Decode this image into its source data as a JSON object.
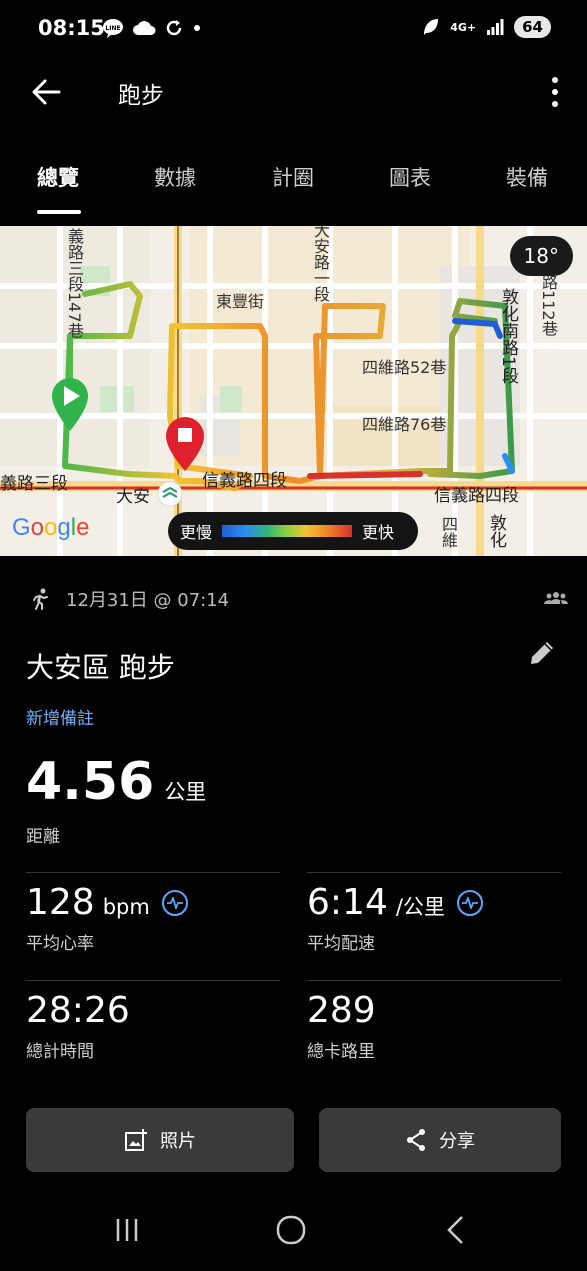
{
  "status_bar": {
    "time": "08:15",
    "network": "4G+",
    "battery": "64"
  },
  "app_bar": {
    "title": "跑步"
  },
  "tabs": [
    {
      "label": "總覽",
      "active": true
    },
    {
      "label": "數據",
      "active": false
    },
    {
      "label": "計圈",
      "active": false
    },
    {
      "label": "圖表",
      "active": false
    },
    {
      "label": "裝備",
      "active": false
    }
  ],
  "map": {
    "temperature": "18°",
    "street_labels": [
      "義路三段147巷",
      "東豐街",
      "大安路一段",
      "敦化南路1段",
      "四維路52巷",
      "四維路76巷",
      "信義路四段",
      "義路三段",
      "大安",
      "信義路四段",
      "路112巷",
      "四維",
      "敦化"
    ],
    "legend": {
      "slow_label": "更慢",
      "fast_label": "更快"
    },
    "google_text": [
      "G",
      "o",
      "o",
      "g",
      "l",
      "e"
    ]
  },
  "activity": {
    "date": "12月31日 @ 07:14",
    "title": "大安區 跑步",
    "add_note": "新增備註",
    "distance": {
      "value": "4.56",
      "unit": "公里",
      "label": "距離"
    },
    "heart_rate": {
      "value": "128",
      "unit": "bpm",
      "label": "平均心率"
    },
    "pace": {
      "value": "6:14",
      "unit": "/公里",
      "label": "平均配速"
    },
    "total_time": {
      "value": "28:26",
      "label": "總計時間"
    },
    "calories": {
      "value": "289",
      "label": "總卡路里"
    }
  },
  "actions": {
    "photo": "照片",
    "share": "分享"
  },
  "colors": {
    "accent_blue": "#6fb1ff",
    "button_bg": "#3a3a3a",
    "route_start": "#2fb34a",
    "route_end": "#e0202d"
  }
}
